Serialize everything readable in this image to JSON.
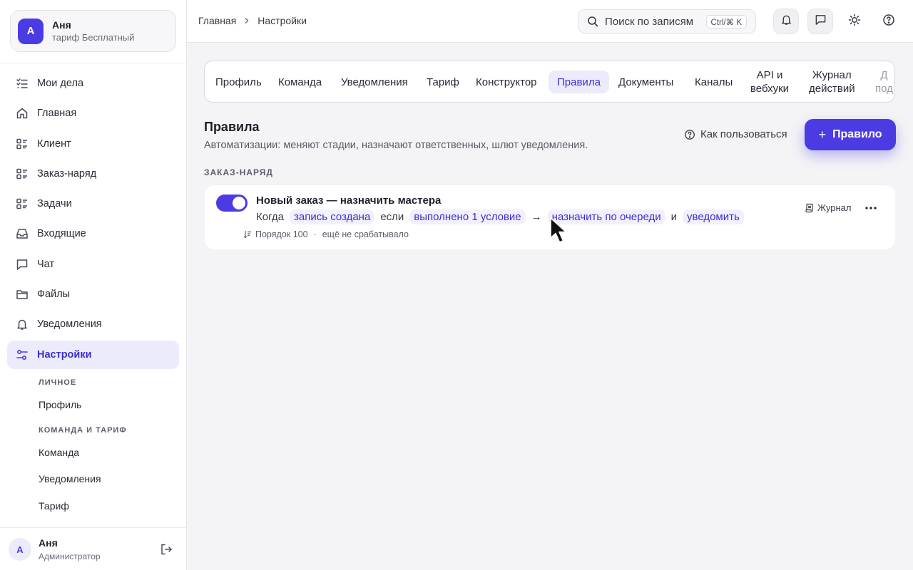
{
  "account": {
    "avatar_letter": "A",
    "name": "Аня",
    "plan": "тариф Бесплатный"
  },
  "sidebar": {
    "items": [
      {
        "label": "Мои дела",
        "icon": "checklist-icon"
      },
      {
        "label": "Главная",
        "icon": "home-icon"
      },
      {
        "label": "Клиент",
        "icon": "list-icon"
      },
      {
        "label": "Заказ-наряд",
        "icon": "list-icon"
      },
      {
        "label": "Задачи",
        "icon": "list-icon"
      },
      {
        "label": "Входящие",
        "icon": "inbox-icon"
      },
      {
        "label": "Чат",
        "icon": "chat-icon"
      },
      {
        "label": "Файлы",
        "icon": "folder-icon"
      },
      {
        "label": "Уведомления",
        "icon": "bell-icon"
      },
      {
        "label": "Настройки",
        "icon": "sliders-icon",
        "active": true
      }
    ],
    "sub": {
      "personal_heading": "ЛИЧНОЕ",
      "profile": "Профиль",
      "team_heading": "КОМАНДА И ТАРИФ",
      "team": "Команда",
      "notifications": "Уведомления",
      "plan": "Тариф"
    },
    "footer": {
      "avatar_letter": "A",
      "name": "Аня",
      "role": "Администратор"
    }
  },
  "topbar": {
    "breadcrumb": [
      "Главная",
      "Настройки"
    ],
    "search_placeholder": "Поиск по записям",
    "search_shortcut": "Ctrl/⌘ K"
  },
  "tabs": [
    {
      "label": "Профиль"
    },
    {
      "label": "Команда"
    },
    {
      "label": "Уведомления"
    },
    {
      "label": "Тариф"
    },
    {
      "label": "Конструктор"
    },
    {
      "label": "Правила",
      "active": true
    },
    {
      "label": "Документы"
    },
    {
      "label": "Каналы"
    },
    {
      "label": "API и",
      "label2": "вебхуки"
    },
    {
      "label": "Журнал",
      "label2": "действий"
    },
    {
      "label": "Д",
      "label2": "под"
    }
  ],
  "page": {
    "title": "Правила",
    "subtitle": "Автоматизации: меняют стадии, назначают ответственных, шлют уведомления.",
    "howto": "Как пользоваться",
    "add_button": "Правило",
    "section": "ЗАКАЗ-НАРЯД"
  },
  "rule": {
    "enabled": true,
    "title": "Новый заказ — назначить мастера",
    "when": "Когда",
    "trigger": "запись создана",
    "if": "если",
    "condition": "выполнено 1 условие",
    "arrow": "→",
    "action1": "назначить по очереди",
    "and": "и",
    "action2": "уведомить",
    "order": "Порядок 100",
    "dot": "·",
    "status": "ещё не срабатывало",
    "journal": "Журнал"
  },
  "colors": {
    "accent": "#4b3be3",
    "accent_soft": "#ecebfb",
    "background": "#f4f4f6"
  }
}
